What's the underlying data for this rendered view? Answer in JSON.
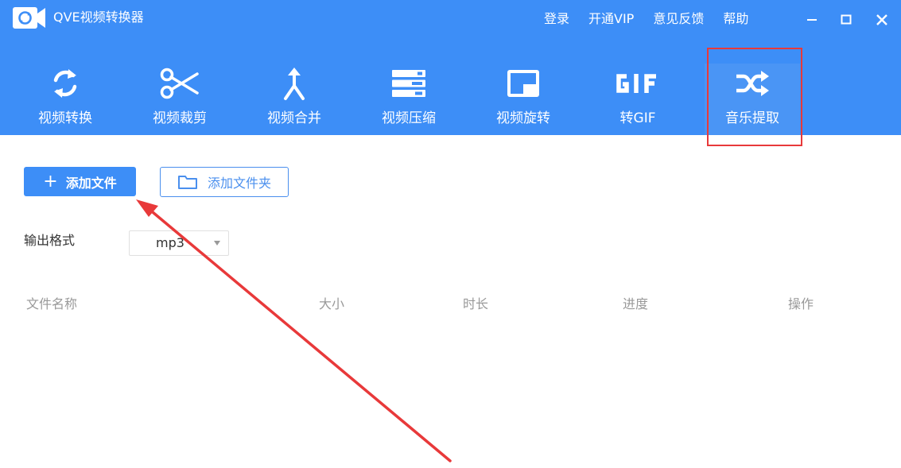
{
  "app": {
    "title": "QVE视频转换器"
  },
  "top_links": [
    "登录",
    "开通VIP",
    "意见反馈",
    "帮助"
  ],
  "toolbar": [
    {
      "label": "视频转换",
      "icon": "sync-icon"
    },
    {
      "label": "视频裁剪",
      "icon": "scissors-icon"
    },
    {
      "label": "视频合并",
      "icon": "merge-icon"
    },
    {
      "label": "视频压缩",
      "icon": "compress-icon"
    },
    {
      "label": "视频旋转",
      "icon": "rotate-icon"
    },
    {
      "label": "转GIF",
      "icon": "gif-icon"
    },
    {
      "label": "音乐提取",
      "icon": "shuffle-icon",
      "selected": true
    }
  ],
  "actions": {
    "add_file": "添加文件",
    "add_folder": "添加文件夹"
  },
  "output_format": {
    "label": "输出格式",
    "value": "mp3"
  },
  "table": {
    "columns": [
      "文件名称",
      "大小",
      "时长",
      "进度",
      "操作"
    ]
  },
  "colors": {
    "primary": "#3d8ef7",
    "annotation": "#e8393a",
    "muted_text": "#999999"
  }
}
